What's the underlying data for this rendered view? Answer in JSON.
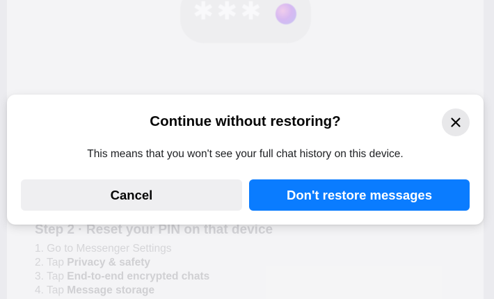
{
  "illustration": {
    "pin_mask": "✱✱✱",
    "icon": "gradient-orb-icon"
  },
  "background": {
    "step_heading": "Step 2 · Reset your PIN on that device",
    "steps": [
      {
        "num": "1.",
        "prefix": "Go to Messenger Settings",
        "bold": ""
      },
      {
        "num": "2.",
        "prefix": "Tap ",
        "bold": "Privacy & safety"
      },
      {
        "num": "3.",
        "prefix": "Tap ",
        "bold": "End-to-end encrypted chats"
      },
      {
        "num": "4.",
        "prefix": "Tap ",
        "bold": "Message storage"
      }
    ]
  },
  "dialog": {
    "title": "Continue without restoring?",
    "body": "This means that you won't see your full chat history on this device.",
    "cancel_label": "Cancel",
    "confirm_label": "Don't restore messages",
    "close_icon": "close-icon",
    "colors": {
      "primary": "#0a7cff",
      "secondary": "#efeff1"
    }
  }
}
